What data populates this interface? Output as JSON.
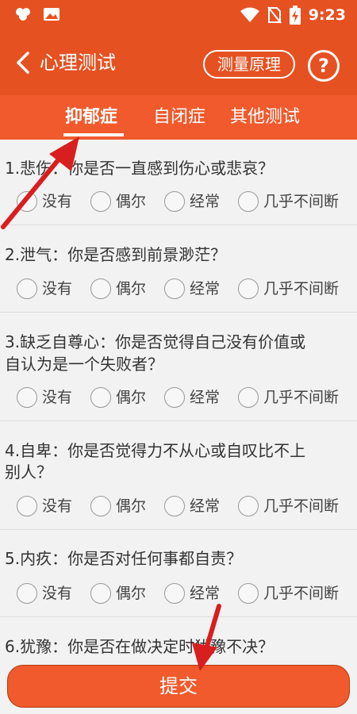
{
  "status_bar": {
    "time": "9:23",
    "icons": [
      "notification-icon",
      "image-icon",
      "wifi-icon",
      "no-sim-icon",
      "battery-charging-icon"
    ]
  },
  "app_bar": {
    "back_icon": "chevron-left-icon",
    "title": "心理测试",
    "principle_button": "测量原理",
    "help_button": "?"
  },
  "tabs": [
    {
      "label": "抑郁症",
      "active": true
    },
    {
      "label": "自闭症",
      "active": false
    },
    {
      "label": "其他测试",
      "active": false
    }
  ],
  "options": [
    "没有",
    "偶尔",
    "经常",
    "几乎不间断"
  ],
  "questions": [
    {
      "line1": "1.悲伤：你是否一直感到伤心或悲哀？",
      "line2": ""
    },
    {
      "line1": "2.泄气：你是否感到前景渺茫？",
      "line2": ""
    },
    {
      "line1": "3.缺乏自尊心：你是否觉得自己没有价值或",
      "line2": "自认为是一个失败者？"
    },
    {
      "line1": "4.自卑：你是否觉得力不从心或自叹比不上",
      "line2": "别人？"
    },
    {
      "line1": "5.内疚：你是否对任何事都自责？",
      "line2": ""
    },
    {
      "line1": "6.犹豫：你是否在做决定时犹豫不决？",
      "line2": ""
    }
  ],
  "submit_button": "提交",
  "annotation_color": "#d81e1e",
  "accent_color": "#e65122"
}
